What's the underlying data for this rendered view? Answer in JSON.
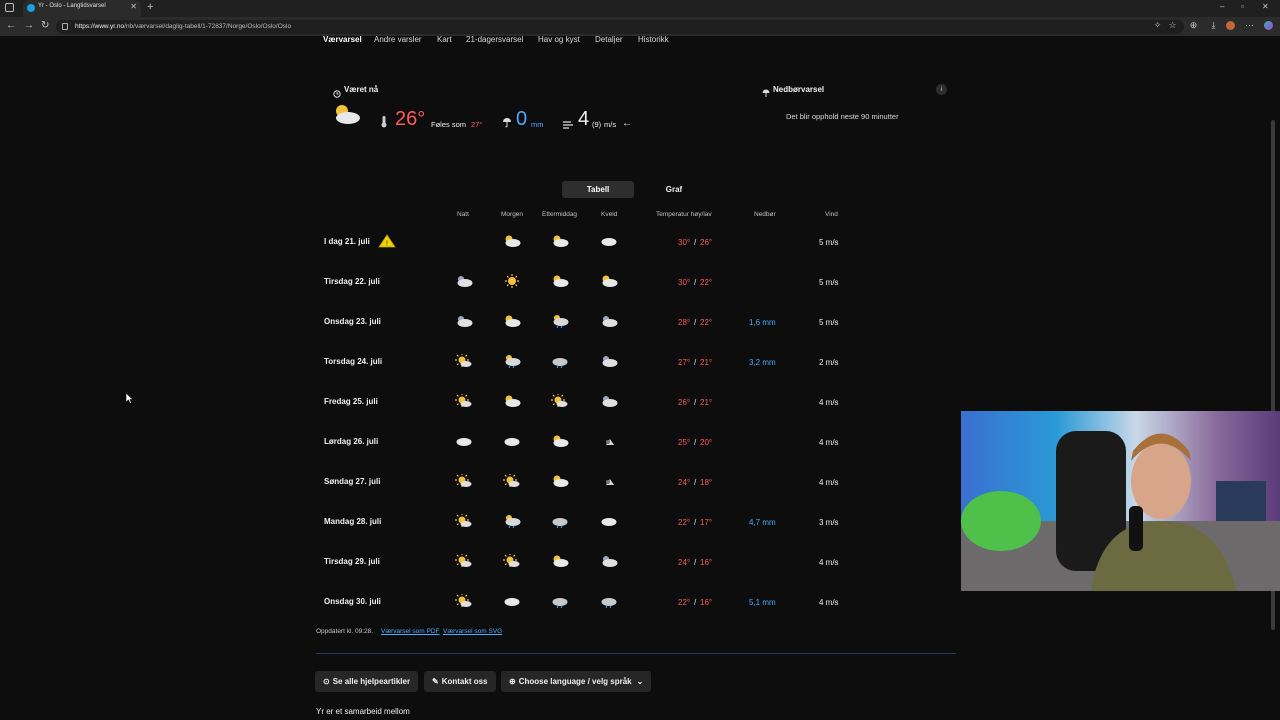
{
  "browser": {
    "tab_title": "Yr - Oslo - Langtidsvarsel",
    "url_host": "https://www.yr.no",
    "url_path": "/nb/værvarsel/daglig-tabell/1-72837/Norge/Oslo/Oslo/Oslo"
  },
  "menu": [
    "Værvarsel",
    "Andre varsler",
    "Kart",
    "21-dagersvarsel",
    "Hav og kyst",
    "Detaljer",
    "Historikk"
  ],
  "now": {
    "heading": "Været nå",
    "temp": "26°",
    "feels_label": "Føles som",
    "feels_value": "27°",
    "precip_value": "0",
    "precip_unit": "mm",
    "wind_value": "4",
    "wind_gust": "(9)",
    "wind_unit": "m/s",
    "wind_arrow": "←"
  },
  "nedbor": {
    "heading": "Nedbørvarsel",
    "text": "Det blir opphold neste 90 minutter",
    "info": "i"
  },
  "toggle": {
    "table": "Tabell",
    "graph": "Graf"
  },
  "columns": {
    "natt": "Natt",
    "morgen": "Morgen",
    "ettermiddag": "Ettermiddag",
    "kveld": "Kveld",
    "temp": "Temperatur høy/lav",
    "nedbor": "Nedbør",
    "vind": "Vind"
  },
  "days": [
    {
      "day": "I dag 21. juli",
      "warning": true,
      "icons": [
        "",
        "partly-cloudy-sun",
        "partly-cloudy-sun",
        "cloud"
      ],
      "high": "30°",
      "low": "26°",
      "precip": "",
      "wind": "5 m/s"
    },
    {
      "day": "Tirsdag 22. juli",
      "icons": [
        "partly-cloudy-night",
        "sun",
        "partly-cloudy-sun",
        "partly-cloudy-sun"
      ],
      "high": "30°",
      "low": "22°",
      "precip": "",
      "wind": "5 m/s"
    },
    {
      "day": "Onsdag 23. juli",
      "icons": [
        "partly-cloudy-night",
        "partly-cloudy-sun",
        "rain-sun",
        "partly-cloudy-night"
      ],
      "high": "28°",
      "low": "22°",
      "precip": "1,6 mm",
      "wind": "5 m/s"
    },
    {
      "day": "Torsdag 24. juli",
      "icons": [
        "fair-sun",
        "rain-sun",
        "rain-cloud",
        "partly-cloudy-night"
      ],
      "high": "27°",
      "low": "21°",
      "precip": "3,2 mm",
      "wind": "2 m/s"
    },
    {
      "day": "Fredag 25. juli",
      "icons": [
        "fair-sun",
        "partly-cloudy-sun",
        "fair-sun",
        "partly-cloudy-night"
      ],
      "high": "26°",
      "low": "21°",
      "precip": "",
      "wind": "4 m/s"
    },
    {
      "day": "Lørdag 26. juli",
      "icons": [
        "cloud",
        "cloud",
        "partly-cloudy-sun",
        "moon-night"
      ],
      "high": "25°",
      "low": "20°",
      "precip": "",
      "wind": "4 m/s"
    },
    {
      "day": "Søndag 27. juli",
      "icons": [
        "fair-sun",
        "fair-sun",
        "partly-cloudy-sun",
        "moon-night"
      ],
      "high": "24°",
      "low": "18°",
      "precip": "",
      "wind": "4 m/s"
    },
    {
      "day": "Mandag 28. juli",
      "icons": [
        "fair-sun",
        "rain-sun",
        "rain-cloud",
        "cloud"
      ],
      "high": "22°",
      "low": "17°",
      "precip": "4,7 mm",
      "wind": "3 m/s"
    },
    {
      "day": "Tirsdag 29. juli",
      "icons": [
        "fair-sun",
        "fair-sun",
        "partly-cloudy-sun",
        "partly-cloudy-night"
      ],
      "high": "24°",
      "low": "16°",
      "precip": "",
      "wind": "4 m/s"
    },
    {
      "day": "Onsdag 30. juli",
      "icons": [
        "fair-sun",
        "cloud",
        "rain-cloud",
        "rain-cloud"
      ],
      "high": "22°",
      "low": "16°",
      "precip": "5,1 mm",
      "wind": "4 m/s"
    }
  ],
  "updated": {
    "text": "Oppdatert kl. 09:28.",
    "pdf": "Værvarsel som PDF",
    "svg": "Værvarsel som SVG"
  },
  "buttons": {
    "help": "Se alle hjelpeartikler",
    "contact": "Kontakt oss",
    "language": "Choose language / velg språk"
  },
  "footer_text": "Yr er et samarbeid mellom"
}
